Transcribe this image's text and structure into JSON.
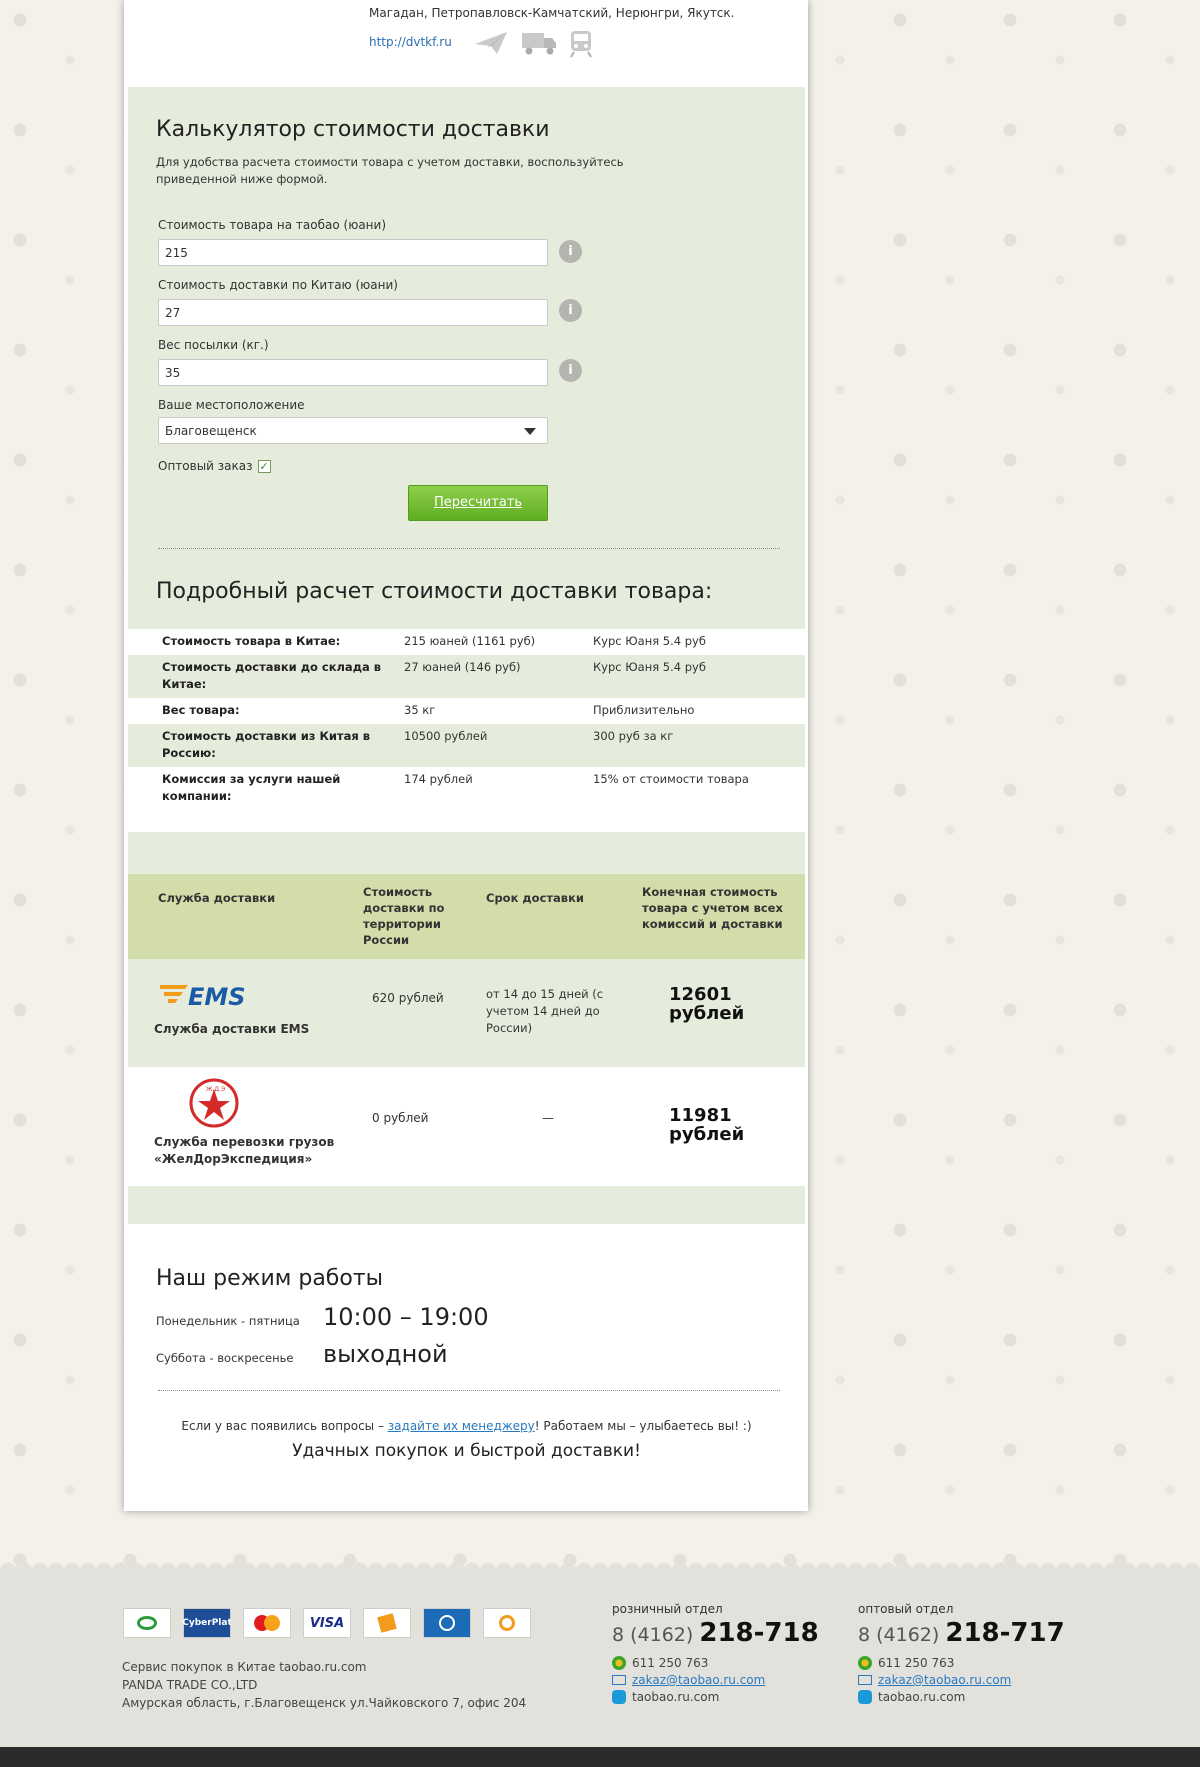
{
  "header": {
    "cities_text": "Магадан, Петропавловск-Камчатский, Нерюнгри, Якутск.",
    "link": "http://dvtkf.ru",
    "transport_icons": [
      "plane-icon",
      "truck-icon",
      "train-icon"
    ]
  },
  "calculator": {
    "title": "Калькулятор стоимости доставки",
    "description": "Для удобства расчета стоимости товара с учетом доставки, воспользуйтесь приведенной ниже формой.",
    "fields": [
      {
        "label": "Стоимость товара на таобао (юани)",
        "value": "215"
      },
      {
        "label": "Стоимость доставки по Китаю (юани)",
        "value": "27"
      },
      {
        "label": "Вес посылки (кг.)",
        "value": "35"
      }
    ],
    "location_label": "Ваше местоположение",
    "location_value": "Благовещенск",
    "wholesale_label": "Оптовый заказ",
    "wholesale_checked": true,
    "button": "Пересчитать"
  },
  "detail": {
    "title": "Подробный расчет стоимости доставки товара:",
    "rows": [
      {
        "name": "Стоимость товара в Китае:",
        "value": "215 юаней (1161 руб)",
        "note": "Курс Юаня 5.4 руб"
      },
      {
        "name": "Стоимость доставки до склада в Китае:",
        "value": "27 юаней (146 руб)",
        "note": "Курс Юаня 5.4 руб"
      },
      {
        "name": "Вес товара:",
        "value": "35 кг",
        "note": "Приблизительно"
      },
      {
        "name": "Стоимость доставки из Китая в Россию:",
        "value": "10500 рублей",
        "note": "300 руб за кг"
      },
      {
        "name": "Комиссия за услуги нашей компании:",
        "value": "174 рублей",
        "note": "15% от стоимости товара"
      }
    ]
  },
  "services": {
    "headers": [
      "Служба доставки",
      "Стоимость доставки по территории России",
      "Срок доставки",
      "Конечная стоимость товара с учетом всех комиссий и доставки"
    ],
    "rows": [
      {
        "logo": "EMS",
        "name": "Служба доставки EMS",
        "cost": "620 рублей",
        "term": "от 14 до 15 дней (с учетом 14 дней до России)",
        "total": "12601 рублей"
      },
      {
        "logo": "Ж.Д.Э",
        "name": "Служба перевозки грузов «ЖелДорЭкспедиция»",
        "cost": "0 рублей",
        "term": "—",
        "total": "11981 рублей"
      }
    ]
  },
  "hours": {
    "title": "Наш режим работы",
    "weekdays_label": "Понедельник - пятница",
    "weekdays_time": "10:00 – 19:00",
    "weekend_label": "Суббота - воскресенье",
    "weekend_time": "выходной"
  },
  "footer_note": {
    "before": "Если у вас появились вопросы – ",
    "link": "задайте их менеджеру",
    "after": "!  Работаем мы –  улыбаетесь вы! :)",
    "wish": "Удачных покупок и быстрой доставки!"
  },
  "footer": {
    "payment_icons": [
      "Сбербанк",
      "CyberPlat",
      "MasterCard",
      "VISA",
      "Яндекс",
      "WebMoney",
      "QIWI"
    ],
    "company_lines": [
      "Сервис покупок в Китае taobao.ru.com",
      "PANDA TRADE CO.,LTD",
      "Амурская область, г.Благовещенск ул.Чайковского 7, офис 204"
    ],
    "retail": {
      "label": "розничный отдел",
      "code": "8 (4162)",
      "number": "218-718",
      "icq": "611 250 763",
      "email": "zakaz@taobao.ru.com",
      "skype": "taobao.ru.com"
    },
    "wholesale": {
      "label": "оптовый отдел",
      "code": "8 (4162)",
      "number": "218-717",
      "icq": "611 250 763",
      "email": "zakaz@taobao.ru.com",
      "skype": "taobao.ru.com"
    }
  }
}
